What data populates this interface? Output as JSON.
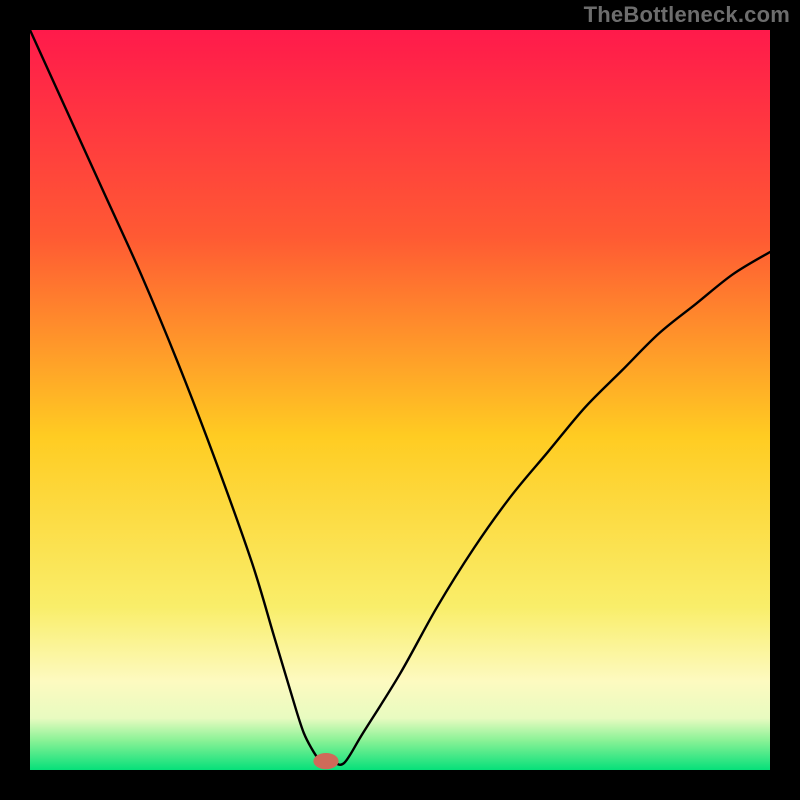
{
  "watermark": "TheBottleneck.com",
  "chart_data": {
    "type": "line",
    "title": "",
    "xlabel": "",
    "ylabel": "",
    "xlim": [
      0,
      100
    ],
    "ylim": [
      0,
      100
    ],
    "background": {
      "stops": [
        {
          "offset": 0,
          "color": "#ff1a4b"
        },
        {
          "offset": 28,
          "color": "#ff5a33"
        },
        {
          "offset": 55,
          "color": "#ffcc22"
        },
        {
          "offset": 78,
          "color": "#f9ee6a"
        },
        {
          "offset": 88,
          "color": "#fdfac0"
        },
        {
          "offset": 93,
          "color": "#e8fbc0"
        },
        {
          "offset": 96,
          "color": "#8af296"
        },
        {
          "offset": 100,
          "color": "#06e07a"
        }
      ]
    },
    "series": [
      {
        "name": "bottleneck-curve",
        "x": [
          0,
          5,
          10,
          15,
          20,
          25,
          30,
          33,
          36,
          37,
          38,
          39,
          40,
          41,
          42.5,
          45,
          50,
          55,
          60,
          65,
          70,
          75,
          80,
          85,
          90,
          95,
          100
        ],
        "values": [
          100,
          89,
          78,
          67,
          55,
          42,
          28,
          18,
          8,
          5,
          3,
          1.5,
          1,
          1,
          1,
          5,
          13,
          22,
          30,
          37,
          43,
          49,
          54,
          59,
          63,
          67,
          70
        ]
      }
    ],
    "marker": {
      "x": 40,
      "y": 1.2,
      "rx": 1.7,
      "ry": 1.1,
      "fill": "#cf6a59"
    }
  }
}
